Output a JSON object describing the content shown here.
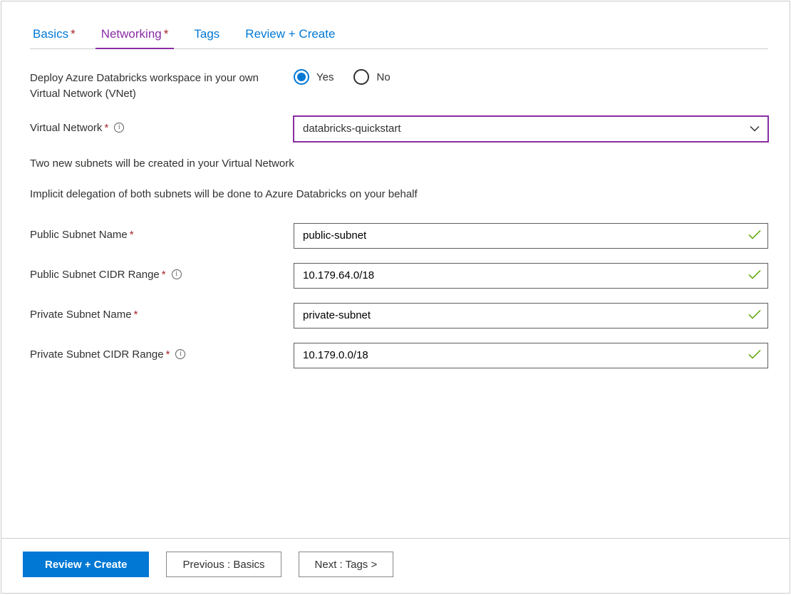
{
  "tabs": [
    {
      "label": "Basics",
      "required": true,
      "color": "blue"
    },
    {
      "label": "Networking",
      "required": true,
      "color": "purple",
      "active": true
    },
    {
      "label": "Tags",
      "required": false,
      "color": "blue"
    },
    {
      "label": "Review + Create",
      "required": false,
      "color": "blue"
    }
  ],
  "deploy_vnet": {
    "label": "Deploy Azure Databricks workspace in your own Virtual Network (VNet)",
    "yes": "Yes",
    "no": "No",
    "selected": "Yes"
  },
  "virtual_network": {
    "label": "Virtual Network",
    "value": "databricks-quickstart"
  },
  "hint1": "Two new subnets will be created in your Virtual Network",
  "hint2": "Implicit delegation of both subnets will be done to Azure Databricks on your behalf",
  "public_subnet_name": {
    "label": "Public Subnet Name",
    "value": "public-subnet"
  },
  "public_subnet_cidr": {
    "label": "Public Subnet CIDR Range",
    "value": "10.179.64.0/18"
  },
  "private_subnet_name": {
    "label": "Private Subnet Name",
    "value": "private-subnet"
  },
  "private_subnet_cidr": {
    "label": "Private Subnet CIDR Range",
    "value": "10.179.0.0/18"
  },
  "footer": {
    "review_create": "Review + Create",
    "previous": "Previous : Basics",
    "next": "Next : Tags >"
  }
}
